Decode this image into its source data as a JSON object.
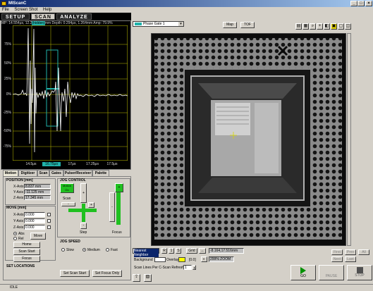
{
  "window": {
    "title": "MIScanC"
  },
  "menu": [
    "File",
    "Screen Shot",
    "Help"
  ],
  "nav": {
    "setup": "SETUP",
    "scan": "SCAN",
    "analyze": "ANALYZE"
  },
  "scope": {
    "readout_pre": "MP: 14.554μs, 12.2",
    "readout_hl": "(hidden)",
    "readout_post": "mm Depth:   0.294μs,   1.264mm Amp: 79.9%",
    "y_labels": [
      "75%",
      "50%",
      "25%",
      "0%",
      "-25%",
      "-50%",
      "-75%"
    ],
    "x_labels": [
      "14.5μs",
      "16.75μs",
      "17μs",
      "17.25μs",
      "17.5μs"
    ],
    "x_highlight_index": 1
  },
  "tabs": [
    "Motion",
    "Digitizer",
    "Scan",
    "Gates",
    "Pulser/Receiver",
    "Palette"
  ],
  "position": {
    "title": "POSITION [mm]",
    "x_label": "X-Axis",
    "x_value": "8.837 mm",
    "y_label": "Y-Axis",
    "y_value": "-11.125 mm",
    "z_label": "Z-Axis",
    "z_value": "17.345 mm"
  },
  "move": {
    "title": "MOVE [mm]",
    "x_label": "X-Axis",
    "x_value": "0.000",
    "y_label": "Y-Axis",
    "y_value": "0.000",
    "z_label": "Z-Axis",
    "z_value": "0.000",
    "abs_label": "Abs",
    "rel_label": "Rel",
    "move_button": "Move",
    "home_button": "Home",
    "scan_start_button": "Scan Start",
    "focus_button": "Focus"
  },
  "jog": {
    "title": "JOG CONTROL",
    "motion_on": "Motion On",
    "scan_label": "Scan",
    "step_label": "Step",
    "focus_label": "Focus",
    "plus": "+",
    "minus": "-"
  },
  "jog_speed": {
    "title": "JOG SPEED",
    "slow": "Slow",
    "medium": "Medium",
    "fast": "Fast"
  },
  "set_locations": {
    "title": "SET LOCATIONS",
    "set_scan_start": "Set Scan Start",
    "set_focus_only": "Set Focus Only"
  },
  "viewer_top": {
    "gate_select": "Phase Gate 1",
    "map_button": "Map",
    "tof_button": "TOF"
  },
  "viewer_bottom": {
    "interp_select": "Nearest Neighbor",
    "r_button": "R",
    "one_button": "1",
    "s_button": "S",
    "grid_button": "Grid",
    "coord_readout": "-8.164,17.516mm",
    "background_label": "Background",
    "overlay_label": "Overlay",
    "overlay_value": "[0.0]",
    "zoom_readout": "299% ZOOM",
    "scan_lines_label": "Scan Lines Per C-Scan Refresh",
    "scan_lines_value": "1"
  },
  "right_nav": {
    "first": "First",
    "prev": "Prev",
    "next": "Next",
    "last": "Last",
    "all": "All"
  },
  "run": {
    "go": "GO",
    "pause": "PAUSE",
    "stop": "STOP"
  },
  "status": {
    "state": "IDLE"
  },
  "colors": {
    "accent": "#20b2aa",
    "grid": "#c0c000",
    "go": "#009000",
    "stop": "#505050"
  }
}
